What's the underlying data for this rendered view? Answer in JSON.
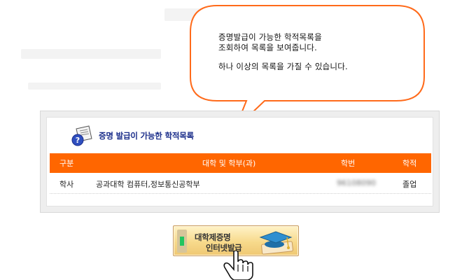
{
  "bubble": {
    "line1": "증명발급이 가능한 학적목록을",
    "line2": "조회하여 목록을 보여줍니다.",
    "line3": "하나 이상의 목록을 가질 수 있습니다."
  },
  "panel": {
    "title": "증명 발급이 가능한 학적목록"
  },
  "table": {
    "headers": {
      "type": "구분",
      "college": "대학 및 학부(과)",
      "student_id": "학번",
      "status": "학적"
    },
    "rows": [
      {
        "type": "학사",
        "college": "공과대학 컴퓨터,정보통신공학부",
        "student_id": "96108090",
        "status": "졸업"
      }
    ]
  },
  "banner": {
    "line1": "대학제증명",
    "line2": "인터넷발급"
  },
  "colors": {
    "header_bg": "#ff6600",
    "title": "#1a2d8a",
    "banner_bg": "#f7d98b"
  },
  "icons": {
    "panel_icon": "document-help-icon",
    "banner_icon": "graduation-cap-icon",
    "cursor": "hand-pointer-icon"
  }
}
